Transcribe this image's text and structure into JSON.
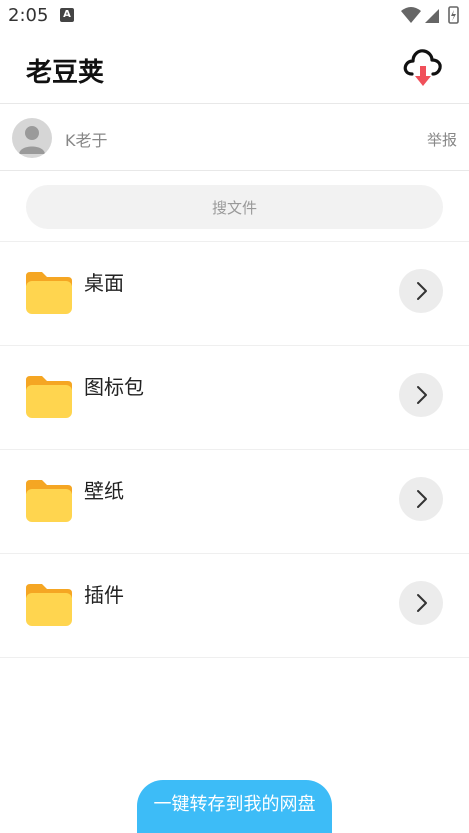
{
  "status_bar": {
    "time": "2:05",
    "notification_badge": "A",
    "icons": [
      "wifi-icon",
      "signal-icon",
      "battery-icon"
    ]
  },
  "app_bar": {
    "title": "老豆荚",
    "action_icon": "cloud-download-icon"
  },
  "owner": {
    "name": "K老于",
    "report_label": "举报",
    "avatar_icon": "user-avatar-icon"
  },
  "search": {
    "placeholder": "搜文件"
  },
  "files": [
    {
      "name": "桌面",
      "icon": "folder-icon"
    },
    {
      "name": "图标包",
      "icon": "folder-icon"
    },
    {
      "name": "壁纸",
      "icon": "folder-icon"
    },
    {
      "name": "插件",
      "icon": "folder-icon"
    }
  ],
  "save_button": {
    "label": "一键转存到我的网盘"
  },
  "colors": {
    "accent": "#3dbcf7",
    "folder_back": "#f5a623",
    "folder_front": "#ffd54f",
    "download_arrow": "#f0505a"
  }
}
